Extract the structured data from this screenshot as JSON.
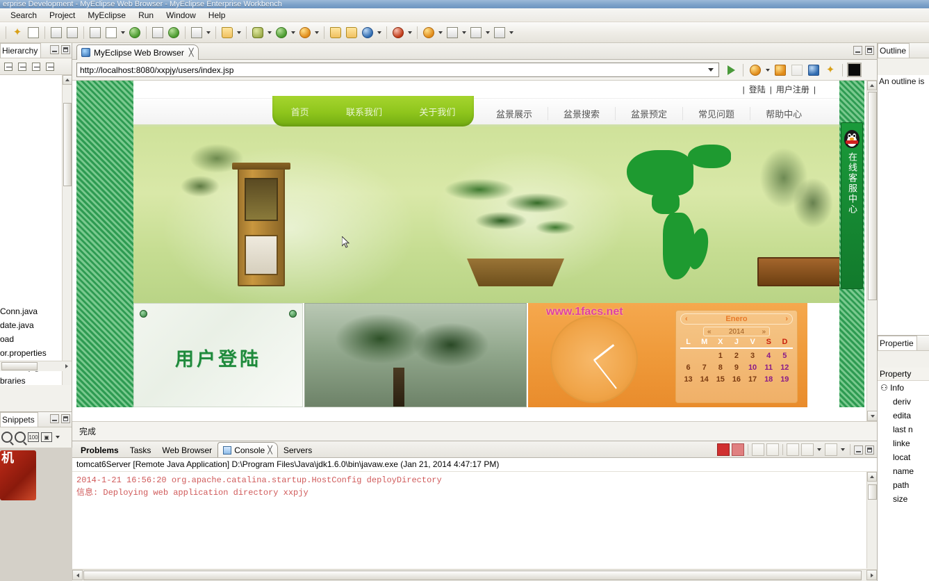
{
  "window": {
    "title": "erprise Development - MyEclipse Web Browser - MyEclipse Enterprise Workbench"
  },
  "menu": {
    "items": [
      "Search",
      "Project",
      "MyEclipse",
      "Run",
      "Window",
      "Help"
    ]
  },
  "left_panel": {
    "tab_label": "Hierarchy",
    "tree_items": [
      "Conn.java",
      "date.java",
      "oad",
      "or.properties",
      "n Library [jdk1",
      "braries"
    ],
    "partial_item": "or",
    "snippets_tab": "Snippets"
  },
  "right_panel": {
    "outline_tab": "Outline",
    "outline_message": "An outline is",
    "properties_tab": "Propertie",
    "properties_header": "Property",
    "property_rows": [
      "Info",
      "deriv",
      "edita",
      "last n",
      "linke",
      "locat",
      "name",
      "path",
      "size"
    ]
  },
  "editor": {
    "tab_label": "MyEclipse Web Browser",
    "tab_close": "╳",
    "url": "http://localhost:8080/xxpjy/users/index.jsp",
    "status": "完成"
  },
  "webpage": {
    "account_links": [
      "|",
      "登陆",
      "|",
      "用户注册",
      "|"
    ],
    "nav_green": [
      "首页",
      "联系我们",
      "关于我们"
    ],
    "nav_items": [
      "盆景展示",
      "盆景搜索",
      "盆景预定",
      "常见问题",
      "帮助中心"
    ],
    "login_card_title": "用户登陆",
    "watermark": "www.1facs.net",
    "qq_text": "在线客服中心",
    "calendar": {
      "month": "Enero",
      "year": "2014",
      "prev": "«",
      "next": "»",
      "prev_month": "‹",
      "next_month": "›",
      "dow": [
        "L",
        "M",
        "X",
        "J",
        "V",
        "S",
        "D"
      ],
      "days": [
        "",
        "",
        "1",
        "2",
        "3",
        "4",
        "5",
        "6",
        "7",
        "8",
        "9",
        "10",
        "11",
        "12",
        "13",
        "14",
        "15",
        "16",
        "17",
        "18",
        "19"
      ]
    }
  },
  "console": {
    "tabs": [
      "Problems",
      "Tasks",
      "Web Browser",
      "Console",
      "Servers"
    ],
    "active_tab": "Console",
    "close_glyph": "╳",
    "process_line": "tomcat6Server [Remote Java Application] D:\\Program Files\\Java\\jdk1.6.0\\bin\\javaw.exe (Jan 21, 2014 4:47:17 PM)",
    "log_lines": [
      "2014-1-21 16:56:20 org.apache.catalina.startup.HostConfig deployDirectory",
      "信息: Deploying web application directory xxpjy"
    ]
  },
  "colors": {
    "accent_green": "#8ec51c",
    "title_blue": "#7ba0c8",
    "panel_bg": "#f2f1ec",
    "orange_card": "#ef9a3a"
  }
}
